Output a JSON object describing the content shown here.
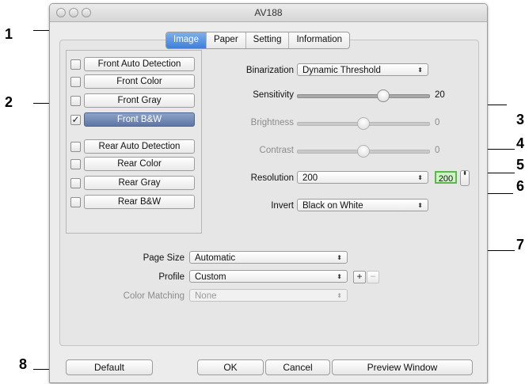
{
  "window": {
    "title": "AV188"
  },
  "tabs": [
    "Image",
    "Paper",
    "Setting",
    "Information"
  ],
  "active_tab": "Image",
  "sources": [
    {
      "label": "Front Auto Detection",
      "checked": false,
      "selected": false
    },
    {
      "label": "Front Color",
      "checked": false,
      "selected": false
    },
    {
      "label": "Front Gray",
      "checked": false,
      "selected": false
    },
    {
      "label": "Front B&W",
      "checked": true,
      "selected": true
    },
    {
      "label": "Rear Auto Detection",
      "checked": false,
      "selected": false
    },
    {
      "label": "Rear Color",
      "checked": false,
      "selected": false
    },
    {
      "label": "Rear Gray",
      "checked": false,
      "selected": false
    },
    {
      "label": "Rear B&W",
      "checked": false,
      "selected": false
    }
  ],
  "settings": {
    "binarization": {
      "label": "Binarization",
      "value": "Dynamic Threshold"
    },
    "sensitivity": {
      "label": "Sensitivity",
      "value": "20",
      "level": 0.65
    },
    "brightness": {
      "label": "Brightness",
      "value": "0",
      "level": 0.5
    },
    "contrast": {
      "label": "Contrast",
      "value": "0",
      "level": 0.5
    },
    "resolution": {
      "label": "Resolution",
      "value": "200",
      "custom_value": "200"
    },
    "invert": {
      "label": "Invert",
      "value": "Black on White"
    }
  },
  "paper": {
    "page_size": {
      "label": "Page Size",
      "value": "Automatic"
    },
    "profile": {
      "label": "Profile",
      "value": "Custom",
      "add": "+",
      "remove": "−"
    },
    "color_matching": {
      "label": "Color Matching",
      "value": "None"
    }
  },
  "buttons": {
    "default": "Default",
    "ok": "OK",
    "cancel": "Cancel",
    "preview": "Preview Window"
  },
  "callouts": [
    "1",
    "2",
    "3",
    "4",
    "5",
    "6",
    "7",
    "8"
  ],
  "glyphs": {
    "updown": "⬍",
    "check": "✓"
  },
  "colors": {
    "selected_source": "#6a7fb0",
    "active_tab": "#4a88dd",
    "resolution_box": "#cdf5c4"
  }
}
